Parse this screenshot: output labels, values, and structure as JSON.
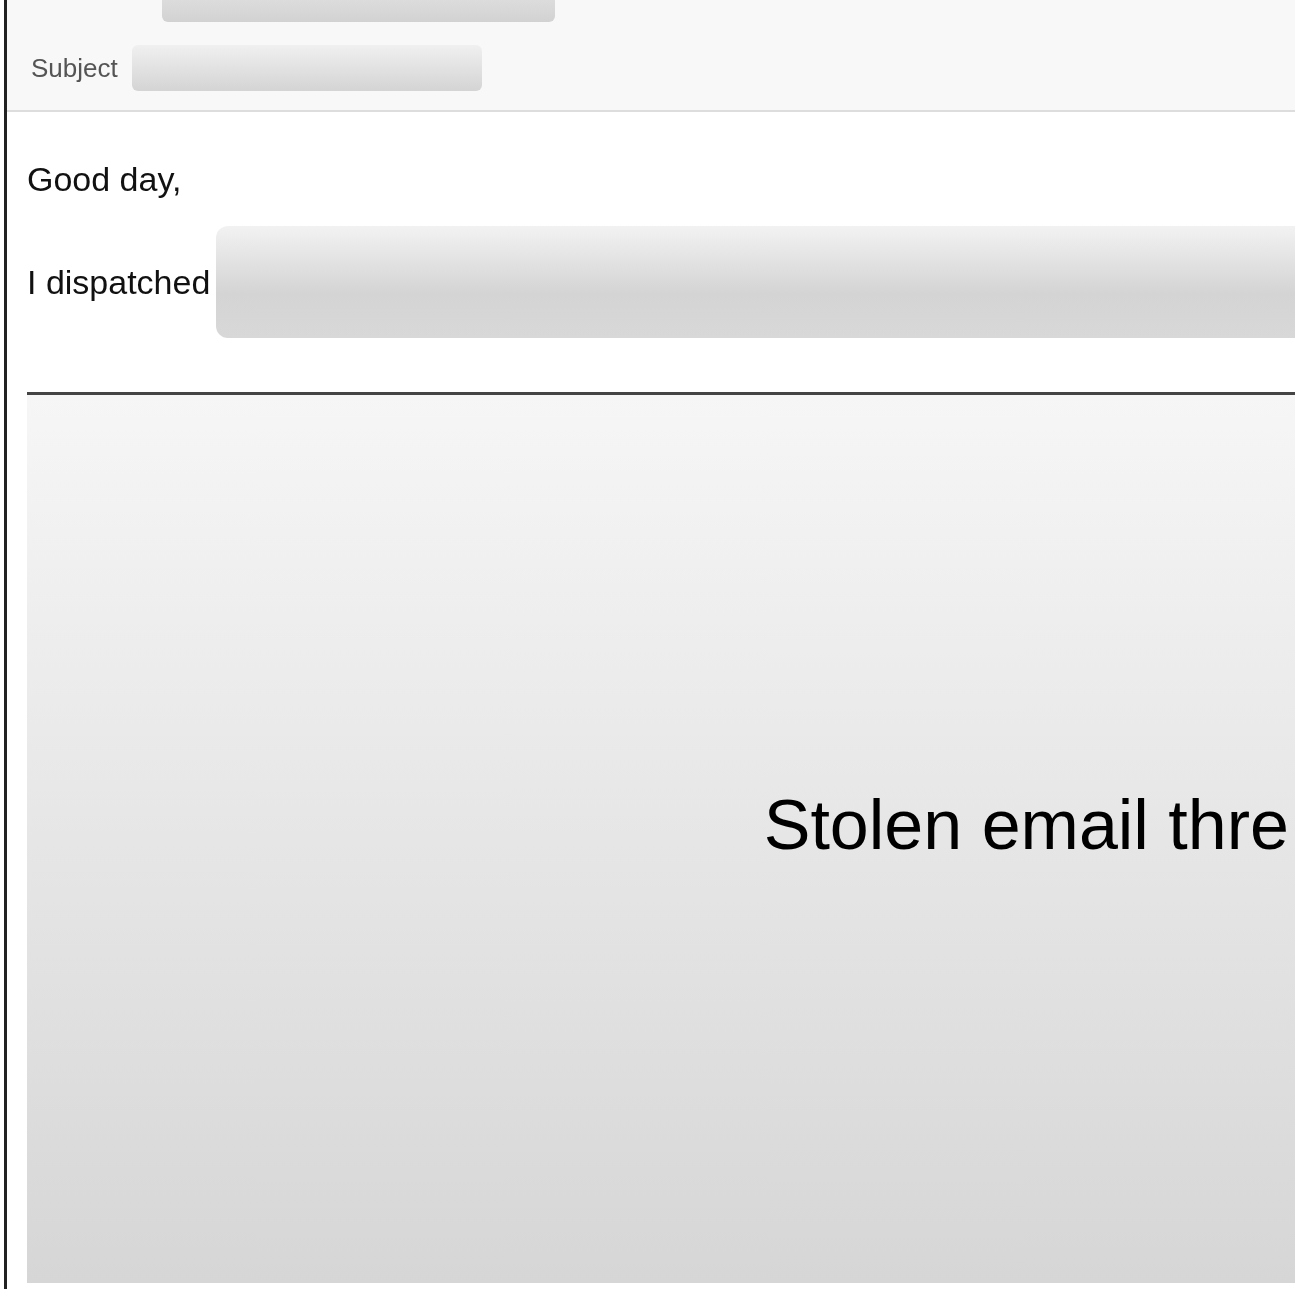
{
  "header": {
    "fields": [
      {
        "kind": "to"
      },
      {
        "kind": "subject",
        "label": "Subject"
      }
    ]
  },
  "body": {
    "greeting": "Good day,",
    "line_start": "I dispatched"
  },
  "slide": {
    "caption": "Stolen email thre"
  }
}
